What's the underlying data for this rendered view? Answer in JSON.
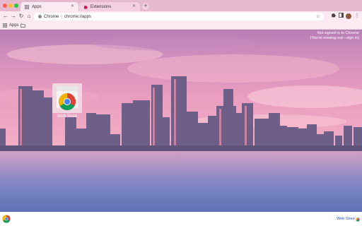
{
  "window": {
    "traffic_lights": [
      "#ff5f57",
      "#febc2e",
      "#28c840"
    ]
  },
  "tabs": [
    {
      "label": "Apps",
      "active": true
    },
    {
      "label": "Extensions",
      "active": false
    }
  ],
  "toolbar": {
    "scheme_label": "Chrome",
    "url": "chrome://apps"
  },
  "bookmarks": {
    "items": [
      {
        "label": "Apps"
      }
    ]
  },
  "content": {
    "notice_line1": "Not signed in to Chrome",
    "notice_line2": "(You're missing out—sign in)",
    "apps": [
      {
        "label": "Web Store",
        "icon": "chrome-web-store-icon"
      }
    ]
  },
  "bottom_bar": {
    "webstore_label": "Web Store"
  },
  "colors": {
    "accent_link": "#2a56c6",
    "tab_strip": "#e7b9cf",
    "toolbar": "#fbeaf2"
  }
}
